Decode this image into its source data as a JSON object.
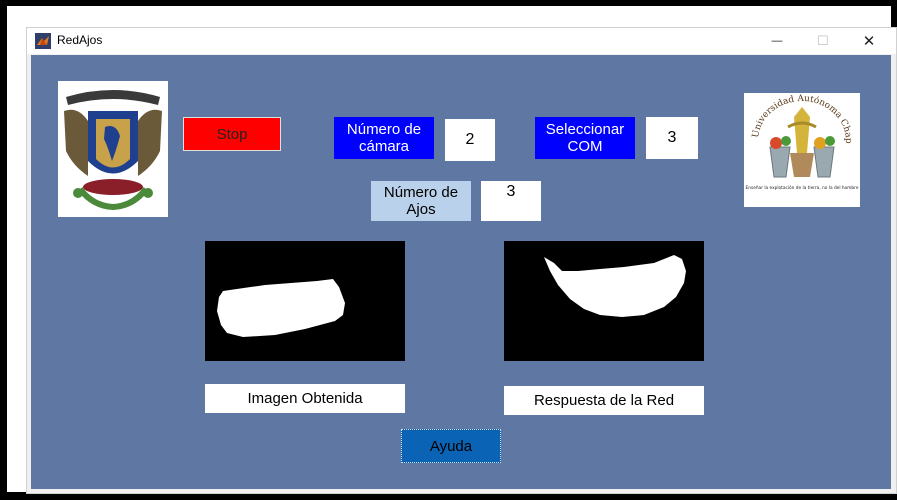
{
  "window": {
    "title": "RedAjos",
    "minimize_glyph": "—",
    "maximize_glyph": "☐",
    "close_glyph": "✕"
  },
  "controls": {
    "stop_label": "Stop",
    "camera_label": "Número de cámara",
    "camera_value": "2",
    "com_label": "Seleccionar COM",
    "com_value": "3",
    "garlic_count_label": "Número de Ajos",
    "garlic_count_value": "3",
    "help_label": "Ayuda"
  },
  "panels": {
    "image_label": "Imagen Obtenida",
    "response_label": "Respuesta de la Red"
  },
  "logos": {
    "left": "unam-crest-logo",
    "right": "chapingo-university-logo",
    "right_arc_text": "Universidad Autónoma Chapingo",
    "right_motto": "Enseñar la explotación de la tierra, no la del hombre"
  },
  "colors": {
    "background": "#5f77a3",
    "stop": "#ff0000",
    "blue_button": "#0000ff",
    "light_blue": "#b9d1ea",
    "help": "#0b63b5"
  }
}
